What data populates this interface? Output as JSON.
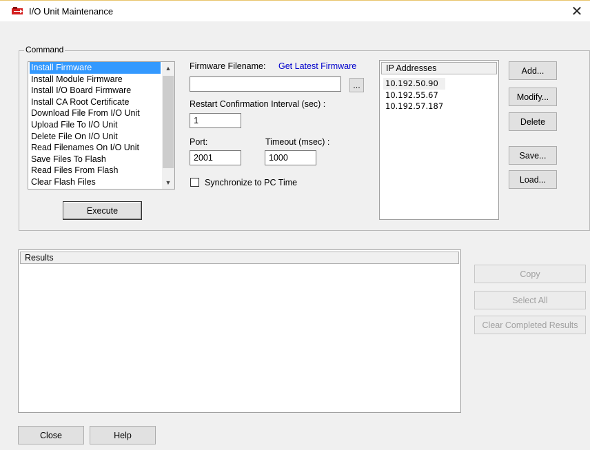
{
  "window": {
    "title": "I/O Unit Maintenance",
    "close_glyph": "✕"
  },
  "command_group": {
    "label": "Command",
    "items": [
      "Install Firmware",
      "Install Module Firmware",
      "Install I/O Board Firmware",
      "Install CA Root Certificate",
      "Download File From I/O Unit",
      "Upload File To I/O Unit",
      "Delete File On I/O Unit",
      "Read Filenames On I/O Unit",
      "Save Files To Flash",
      "Read Files From Flash",
      "Clear Flash Files"
    ],
    "selected_index": 0,
    "execute_label": "Execute"
  },
  "firmware": {
    "filename_label": "Firmware Filename:",
    "latest_link": "Get Latest Firmware",
    "filename_value": "",
    "browse_label": "...",
    "restart_label": "Restart Confirmation Interval (sec) :",
    "restart_value": "1",
    "port_label": "Port:",
    "port_value": "2001",
    "timeout_label": "Timeout (msec) :",
    "timeout_value": "1000",
    "sync_label": "Synchronize to PC Time",
    "sync_checked": false
  },
  "ip_list": {
    "header": "IP Addresses",
    "items": [
      "10.192.50.90",
      "10.192.55.67",
      "10.192.57.187"
    ]
  },
  "ip_buttons": {
    "add": "Add...",
    "modify": "Modify...",
    "delete": "Delete",
    "save": "Save...",
    "load": "Load..."
  },
  "results": {
    "header": "Results",
    "copy": "Copy",
    "select_all": "Select All",
    "clear_completed": "Clear Completed Results"
  },
  "footer": {
    "close": "Close",
    "help": "Help"
  },
  "colors": {
    "selection": "#3399ff",
    "link": "#0000cc",
    "icon_red": "#d42020"
  }
}
